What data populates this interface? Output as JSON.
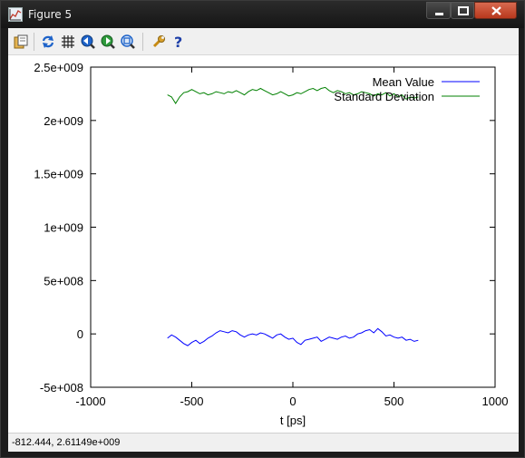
{
  "window": {
    "title": "Figure 5",
    "icons": {
      "app": "plot-icon",
      "minimize": "minimize-icon",
      "maximize": "maximize-icon",
      "close": "close-icon"
    }
  },
  "toolbar": {
    "buttons": [
      {
        "name": "copy-to-clipboard-icon"
      },
      {
        "name": "replot-icon"
      },
      {
        "name": "grid-icon"
      },
      {
        "name": "zoom-previous-icon"
      },
      {
        "name": "zoom-next-icon"
      },
      {
        "name": "autoscale-icon"
      },
      {
        "name": "options-wrench-icon"
      },
      {
        "name": "help-icon"
      }
    ]
  },
  "status": {
    "coordinates": "-812.444,  2.61149e+009"
  },
  "chart_data": {
    "type": "line",
    "xlabel": "t [ps]",
    "ylabel": "",
    "xlim": [
      -1000,
      1000
    ],
    "ylim": [
      -500000000,
      2500000000
    ],
    "xticks": [
      -1000,
      -500,
      0,
      500,
      1000
    ],
    "xtick_labels": [
      "-1000",
      "-500",
      "0",
      "500",
      "1000"
    ],
    "yticks": [
      -500000000,
      0,
      500000000,
      1000000000,
      1500000000,
      2000000000,
      2500000000
    ],
    "ytick_labels": [
      "-5e+008",
      "0",
      "5e+008",
      "1e+009",
      "1.5e+009",
      "2e+009",
      "2.5e+009"
    ],
    "grid": false,
    "legend_position": "top-right",
    "series": [
      {
        "name": "Mean Value",
        "color": "#0000ff",
        "x": [
          -620,
          -600,
          -580,
          -560,
          -540,
          -520,
          -500,
          -480,
          -460,
          -440,
          -420,
          -400,
          -380,
          -360,
          -340,
          -320,
          -300,
          -280,
          -260,
          -240,
          -220,
          -200,
          -180,
          -160,
          -140,
          -120,
          -100,
          -80,
          -60,
          -40,
          -20,
          0,
          20,
          40,
          60,
          80,
          100,
          120,
          140,
          160,
          180,
          200,
          220,
          240,
          260,
          280,
          300,
          320,
          340,
          360,
          380,
          400,
          420,
          440,
          460,
          480,
          500,
          520,
          540,
          560,
          580,
          600,
          620
        ],
        "y": [
          -40000000,
          -10000000,
          -30000000,
          -60000000,
          -90000000,
          -110000000,
          -80000000,
          -60000000,
          -90000000,
          -70000000,
          -40000000,
          -20000000,
          10000000,
          30000000,
          20000000,
          10000000,
          30000000,
          20000000,
          -10000000,
          -30000000,
          -10000000,
          0,
          -10000000,
          10000000,
          0,
          -20000000,
          -40000000,
          -10000000,
          0,
          -30000000,
          -50000000,
          -40000000,
          -80000000,
          -100000000,
          -60000000,
          -50000000,
          -40000000,
          -30000000,
          -70000000,
          -50000000,
          -30000000,
          -40000000,
          -50000000,
          -30000000,
          -20000000,
          -40000000,
          -30000000,
          0,
          10000000,
          30000000,
          40000000,
          10000000,
          50000000,
          20000000,
          -20000000,
          -10000000,
          -30000000,
          -40000000,
          -30000000,
          -60000000,
          -50000000,
          -70000000,
          -60000000
        ]
      },
      {
        "name": "Standard Deviation",
        "color": "#008000",
        "x": [
          -620,
          -600,
          -580,
          -560,
          -540,
          -520,
          -500,
          -480,
          -460,
          -440,
          -420,
          -400,
          -380,
          -360,
          -340,
          -320,
          -300,
          -280,
          -260,
          -240,
          -220,
          -200,
          -180,
          -160,
          -140,
          -120,
          -100,
          -80,
          -60,
          -40,
          -20,
          0,
          20,
          40,
          60,
          80,
          100,
          120,
          140,
          160,
          180,
          200,
          220,
          240,
          260,
          280,
          300,
          320,
          340,
          360,
          380,
          400,
          420,
          440,
          460,
          480,
          500,
          520,
          540,
          560,
          580,
          600,
          620
        ],
        "y": [
          2240000000,
          2220000000,
          2160000000,
          2220000000,
          2260000000,
          2270000000,
          2290000000,
          2270000000,
          2250000000,
          2260000000,
          2240000000,
          2250000000,
          2270000000,
          2260000000,
          2250000000,
          2270000000,
          2260000000,
          2280000000,
          2260000000,
          2240000000,
          2270000000,
          2290000000,
          2280000000,
          2300000000,
          2280000000,
          2260000000,
          2240000000,
          2250000000,
          2270000000,
          2250000000,
          2230000000,
          2240000000,
          2260000000,
          2250000000,
          2270000000,
          2290000000,
          2300000000,
          2280000000,
          2300000000,
          2310000000,
          2280000000,
          2260000000,
          2280000000,
          2270000000,
          2250000000,
          2260000000,
          2240000000,
          2250000000,
          2270000000,
          2260000000,
          2250000000,
          2230000000,
          2250000000,
          2240000000,
          2260000000,
          2230000000,
          2250000000,
          2220000000,
          2240000000,
          2200000000,
          2220000000,
          2210000000,
          2220000000
        ]
      }
    ]
  }
}
